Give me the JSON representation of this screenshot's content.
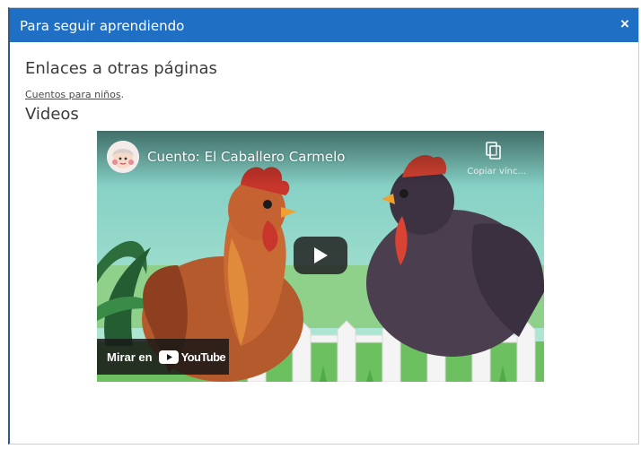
{
  "dialog": {
    "title": "Para seguir aprendiendo",
    "close_symbol": "×"
  },
  "sections": {
    "links_heading": "Enlaces a otras páginas",
    "link_text": "Cuentos para niños",
    "link_suffix": ".",
    "videos_heading": "Videos"
  },
  "video": {
    "title": "Cuento: El Caballero Carmelo",
    "copy_label": "Copiar vínc...",
    "watch_label": "Mirar en",
    "youtube_word": "YouTube",
    "icons": [
      "channel-avatar",
      "copy-link-icon",
      "play-icon",
      "youtube-logo-icon"
    ]
  },
  "colors": {
    "titlebar": "#1f6fc5",
    "youtube_red": "#ff0000"
  }
}
